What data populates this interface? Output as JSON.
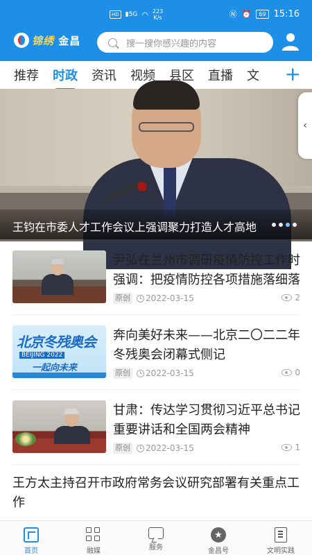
{
  "status_bar": {
    "network": "HD",
    "signal": "5G",
    "speed_value": "223",
    "speed_unit": "K/s",
    "battery": "69",
    "time": "15:16"
  },
  "header": {
    "logo_text_a": "锦绣",
    "logo_text_b": "金昌",
    "search_placeholder": "搜一搜你感兴趣的内容"
  },
  "tabs": [
    {
      "label": "推荐",
      "active": false
    },
    {
      "label": "时政",
      "active": true
    },
    {
      "label": "资讯",
      "active": false
    },
    {
      "label": "视频",
      "active": false
    },
    {
      "label": "县区",
      "active": false
    },
    {
      "label": "直播",
      "active": false
    },
    {
      "label": "文",
      "active": false
    }
  ],
  "add_tab_label": "+",
  "banner": {
    "caption": "王钧在市委人才工作会议上强调聚力打造人才高地",
    "slide_count": 4,
    "active_slide": 3,
    "handle_glyph": "‹"
  },
  "news": [
    {
      "title": "尹弘在兰州市调研疫情防控工作时强调：把疫情防控各项措施落细落实",
      "tag": "原创",
      "date": "2022-03-15",
      "views": "2"
    },
    {
      "title": "奔向美好未来——北京二〇二二年冬残奥会闭幕式侧记",
      "tag": "原创",
      "date": "2022-03-15",
      "views": "0",
      "thumb_text_main": "北京冬残奥会",
      "thumb_text_tag": "BEIJING 2022",
      "thumb_text_sub": "一起向未来"
    },
    {
      "title": "甘肃：传达学习贯彻习近平总书记重要讲话和全国两会精神",
      "tag": "原创",
      "date": "2022-03-15",
      "views": "1"
    }
  ],
  "text_article": {
    "title": "王方太主持召开市政府常务会议研究部署有关重点工作"
  },
  "bottom_nav": [
    {
      "label": "首页",
      "icon": "home-icon",
      "active": true
    },
    {
      "label": "融媒",
      "icon": "media-grid-icon",
      "active": false
    },
    {
      "label": "服务",
      "icon": "service-chat-icon",
      "active": false
    },
    {
      "label": "金昌号",
      "icon": "star-badge-icon",
      "active": false
    },
    {
      "label": "文明实践",
      "icon": "document-icon",
      "active": false
    }
  ],
  "colors": {
    "brand": "#1e8fe6",
    "text": "#222222",
    "meta": "#999999"
  }
}
